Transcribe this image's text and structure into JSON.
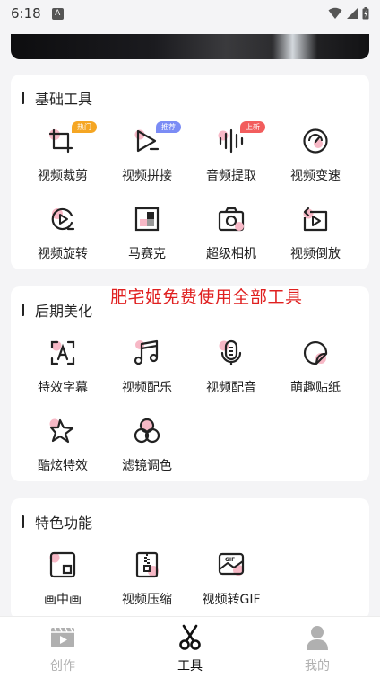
{
  "status_bar": {
    "time": "6:18",
    "notification_badge": "A"
  },
  "sections": [
    {
      "title": "基础工具",
      "tools": [
        {
          "label": "视频裁剪",
          "icon": "crop-icon",
          "badge": "热门",
          "badge_color": "#f5a623"
        },
        {
          "label": "视频拼接",
          "icon": "splice-icon",
          "badge": "推荐",
          "badge_color": "#7b8cf5"
        },
        {
          "label": "音频提取",
          "icon": "audio-wave-icon",
          "badge": "上新",
          "badge_color": "#f25d5d"
        },
        {
          "label": "视频变速",
          "icon": "speedometer-icon"
        },
        {
          "label": "视频旋转",
          "icon": "rotate-play-icon"
        },
        {
          "label": "马赛克",
          "icon": "mosaic-icon"
        },
        {
          "label": "超级相机",
          "icon": "camera-icon"
        },
        {
          "label": "视频倒放",
          "icon": "reverse-icon"
        }
      ]
    },
    {
      "title": "后期美化",
      "tools": [
        {
          "label": "特效字幕",
          "icon": "subtitle-icon"
        },
        {
          "label": "视频配乐",
          "icon": "music-note-icon"
        },
        {
          "label": "视频配音",
          "icon": "microphone-icon"
        },
        {
          "label": "萌趣贴纸",
          "icon": "sticker-icon"
        },
        {
          "label": "酷炫特效",
          "icon": "star-effect-icon"
        },
        {
          "label": "滤镜调色",
          "icon": "filter-circles-icon"
        }
      ]
    },
    {
      "title": "特色功能",
      "tools": [
        {
          "label": "画中画",
          "icon": "picture-in-picture-icon"
        },
        {
          "label": "视频压缩",
          "icon": "compress-zip-icon"
        },
        {
          "label": "视频转GIF",
          "icon": "gif-icon"
        }
      ]
    }
  ],
  "overlay_text": "肥宅姬免费使用全部工具",
  "tab_bar": [
    {
      "label": "创作",
      "icon": "film-play-icon",
      "active": false
    },
    {
      "label": "工具",
      "icon": "scissors-icon",
      "active": true
    },
    {
      "label": "我的",
      "icon": "person-icon",
      "active": false
    }
  ],
  "colors": {
    "accent_pink": "#f7b8c6",
    "icon_stroke": "#222222",
    "inactive_tab": "#b0b0b0"
  }
}
